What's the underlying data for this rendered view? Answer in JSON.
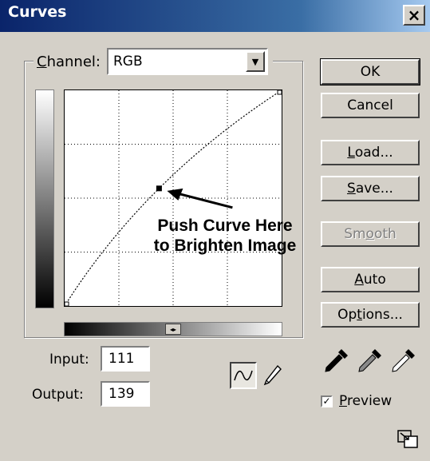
{
  "window": {
    "title": "Curves",
    "close_label": "×"
  },
  "channel": {
    "label": "Channel:",
    "label_accel": "C",
    "label_rest": "hannel:",
    "value": "RGB"
  },
  "annotation": {
    "line1": "Push Curve Here",
    "line2": "to Brighten Image"
  },
  "io": {
    "input_label": "Input:",
    "input_value": "111",
    "output_label": "Output:",
    "output_value": "139"
  },
  "buttons": {
    "ok": "OK",
    "cancel": "Cancel",
    "load": {
      "label": "Load...",
      "accel": "L",
      "rest": "oad..."
    },
    "save": {
      "label": "Save...",
      "accel": "S",
      "rest": "ave..."
    },
    "smooth": {
      "label": "Smooth",
      "pre": "Sm",
      "accel": "o",
      "rest": "oth"
    },
    "auto": {
      "label": "Auto",
      "accel": "A",
      "rest": "uto"
    },
    "options": {
      "label": "Options...",
      "pre": "Op",
      "accel": "t",
      "rest": "ions..."
    }
  },
  "preview": {
    "label": "Preview",
    "accel": "P",
    "rest": "review",
    "checked": true,
    "check_glyph": "✓"
  },
  "curve": {
    "input": 111,
    "output": 139,
    "range": [
      0,
      255
    ]
  },
  "gradient_toggle": "◂▸",
  "icons": [
    "curve-tool-icon",
    "pencil-tool-icon",
    "black-eyedropper-icon",
    "gray-eyedropper-icon",
    "white-eyedropper-icon",
    "resize-icon"
  ]
}
